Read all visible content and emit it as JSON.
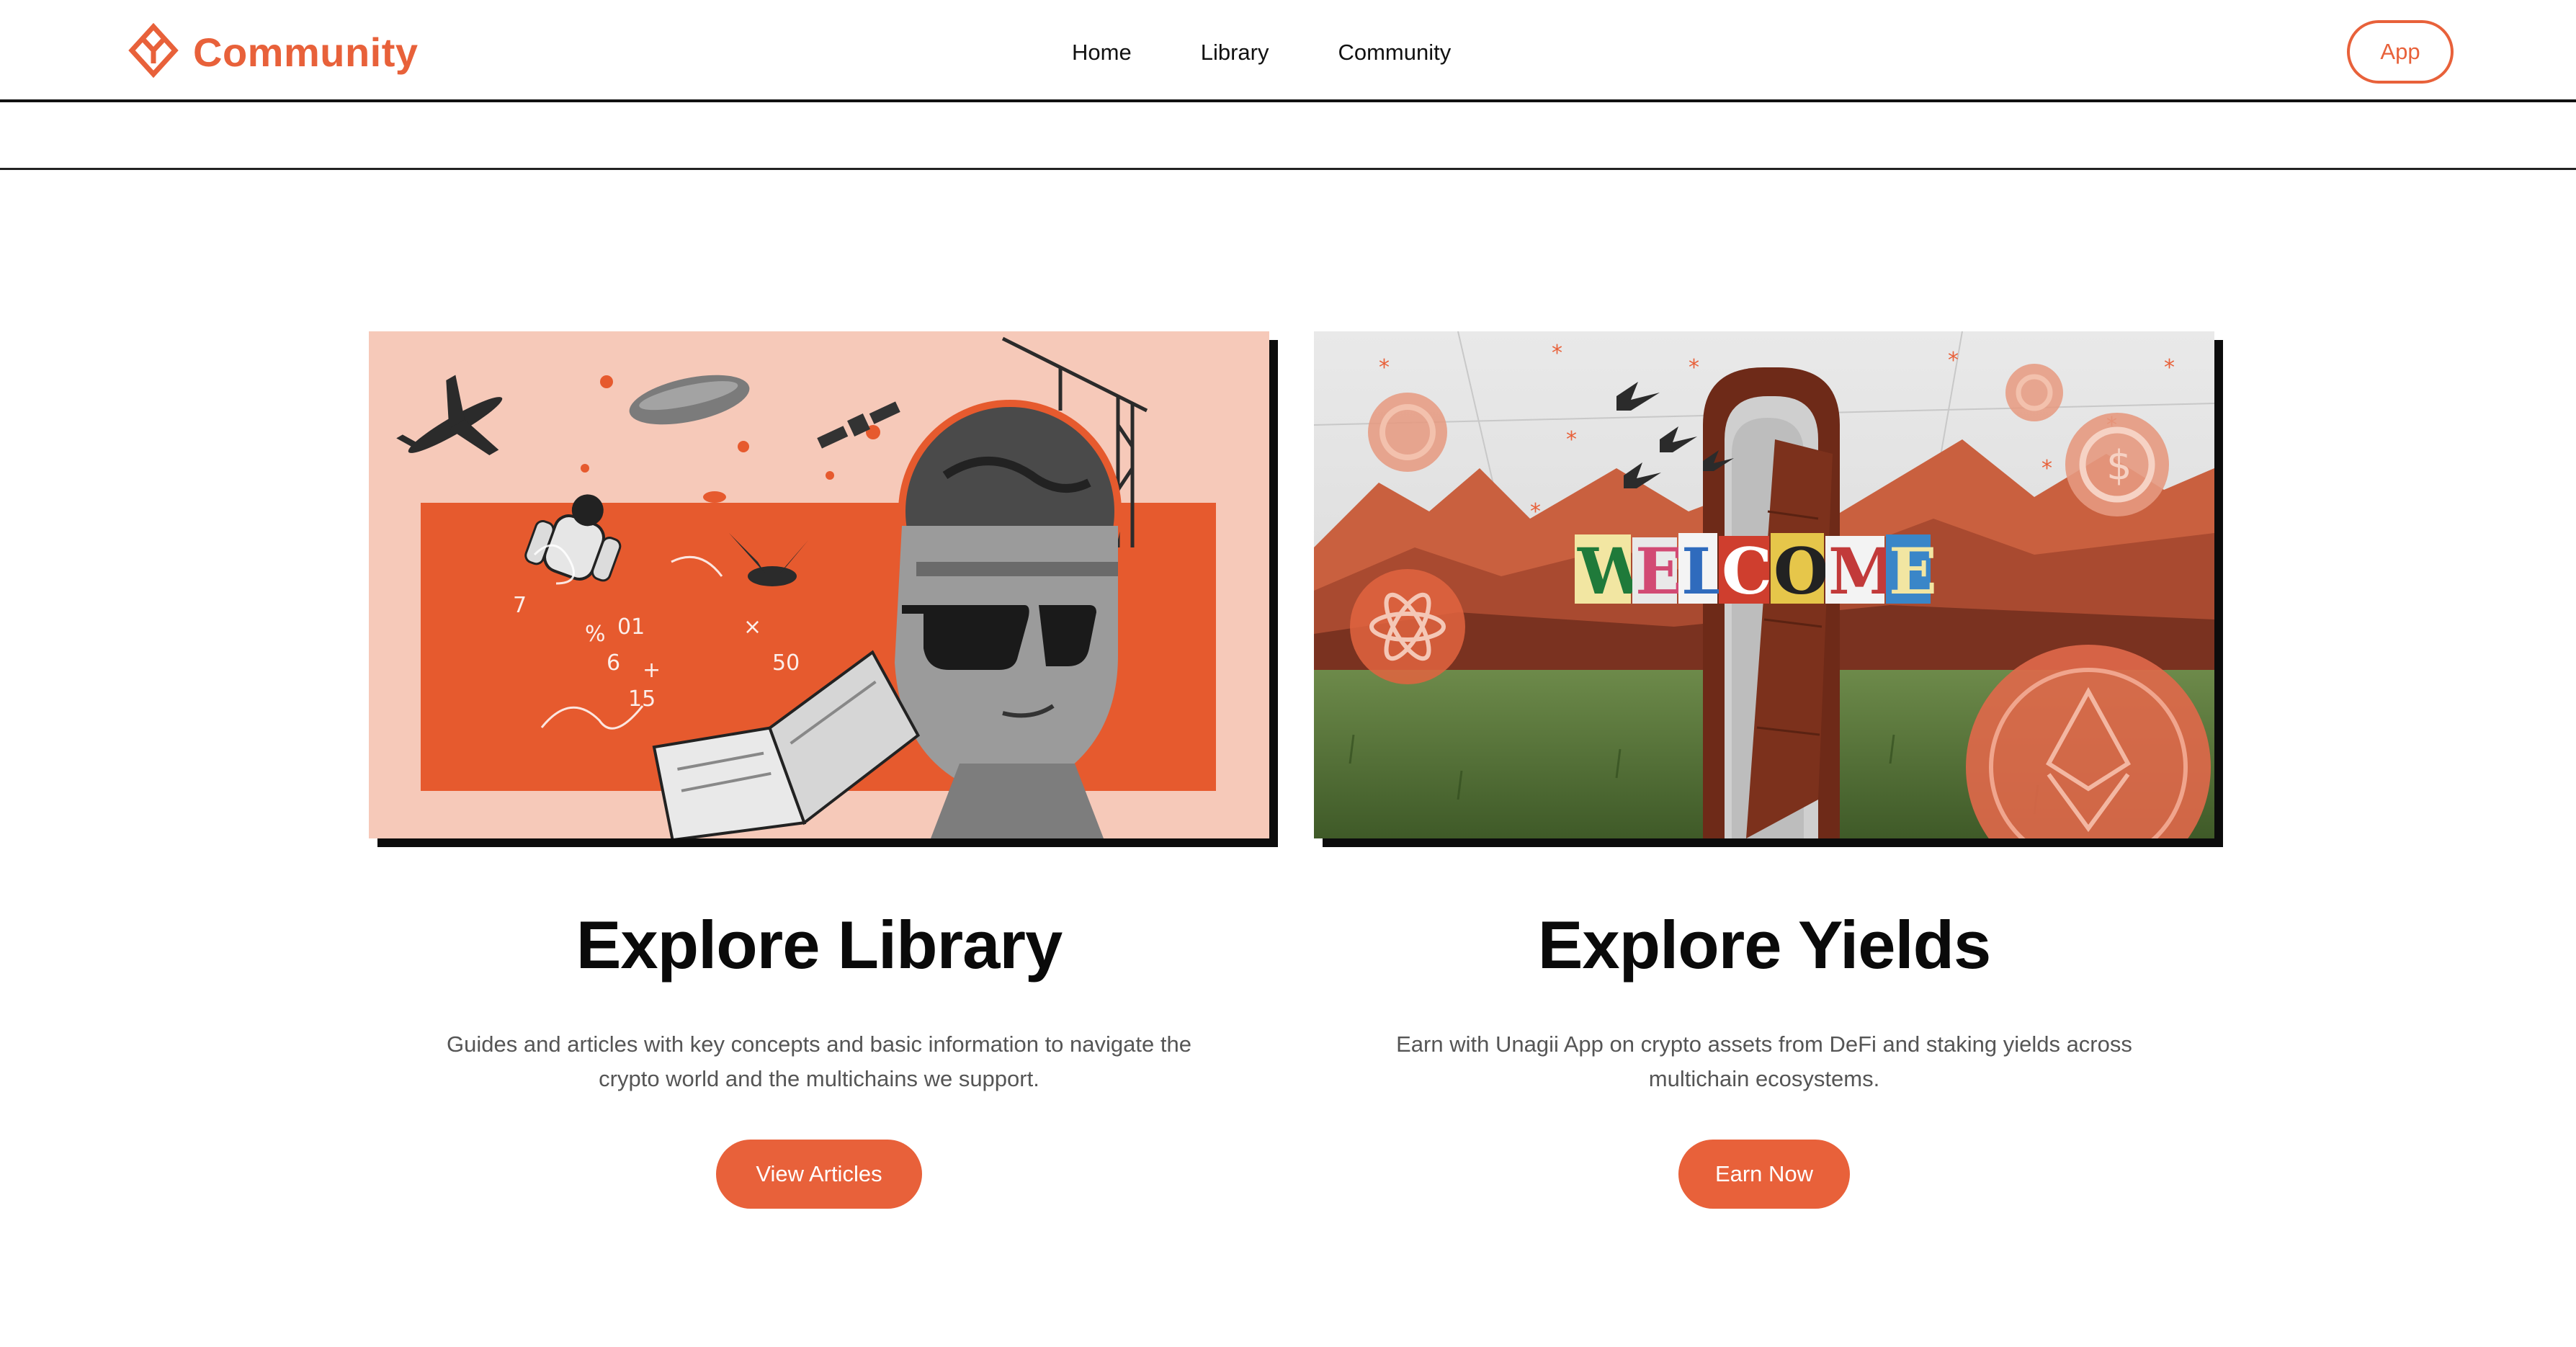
{
  "header": {
    "logo_text": "Community",
    "nav": [
      "Home",
      "Library",
      "Community"
    ],
    "app_button": "App"
  },
  "cards": [
    {
      "title": "Explore Library",
      "description": "Guides and articles with key concepts and basic information to navigate the crypto world and the multichains we support.",
      "button": "View Articles",
      "image": "collage-reading-book-illustration"
    },
    {
      "title": "Explore Yields",
      "description": "Earn with Unagii App on crypto assets from DeFi and staking yields across multichain ecosystems.",
      "button": "Earn Now",
      "image": "collage-welcome-door-illustration",
      "welcome_text": "WELCOME"
    }
  ],
  "colors": {
    "accent": "#e8613a",
    "text": "#111111",
    "muted": "#555555"
  }
}
